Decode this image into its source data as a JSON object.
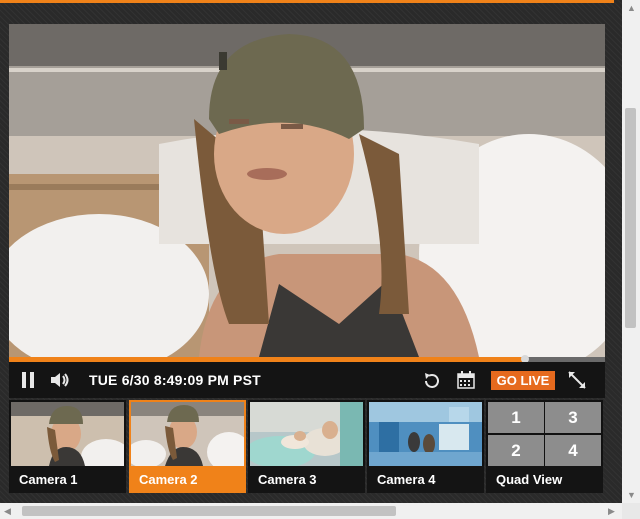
{
  "player": {
    "accent_color": "#f08219",
    "progress_fraction": 0.865,
    "timestamp": "TUE 6/30 8:49:09 PM PST",
    "go_live_label": "GO LIVE",
    "icons": [
      "pause-icon",
      "volume-icon",
      "rewind-icon",
      "calendar-icon",
      "fullscreen-icon"
    ]
  },
  "thumbnails": [
    {
      "label": "Camera 1",
      "active": false
    },
    {
      "label": "Camera 2",
      "active": true
    },
    {
      "label": "Camera 3",
      "active": false
    },
    {
      "label": "Camera 4",
      "active": false
    },
    {
      "label": "Quad View",
      "active": false,
      "cells": [
        "1",
        "2",
        "3",
        "4"
      ]
    }
  ]
}
